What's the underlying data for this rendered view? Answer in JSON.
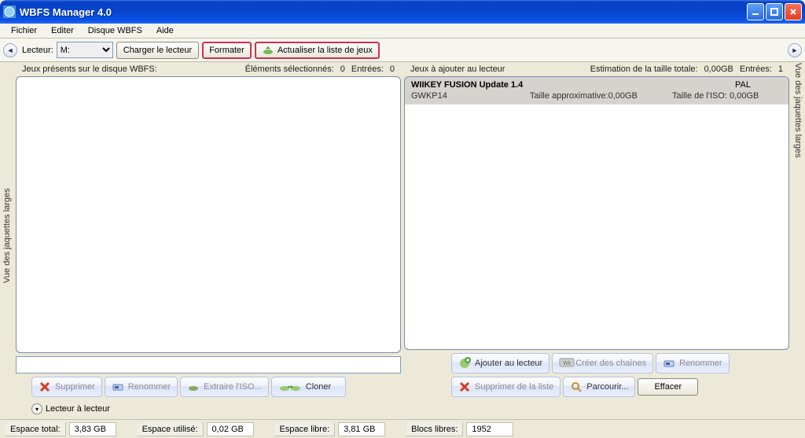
{
  "window": {
    "title": "WBFS Manager 4.0"
  },
  "menu": {
    "items": [
      "Fichier",
      "Editer",
      "Disque WBFS",
      "Aide"
    ]
  },
  "toolbar": {
    "drive_label": "Lecteur:",
    "drive_selected": "M:",
    "load_btn": "Charger le lecteur",
    "format_btn": "Formater",
    "refresh_btn": "Actualiser la liste de jeux"
  },
  "side_tab": {
    "left": "Vue des jaquettes larges",
    "right": "Vue des jaquettes larges"
  },
  "left_panel": {
    "title": "Jeux présents sur le disque WBFS:",
    "sel_label": "Éléments sélectionnés:",
    "sel_count": "0",
    "entries_label": "Entrées:",
    "entries_count": "0",
    "buttons": {
      "delete": "Supprimer",
      "rename": "Renommer",
      "extract": "Extraire l'ISO...",
      "clone": "Cloner"
    }
  },
  "right_panel": {
    "title": "Jeux à ajouter au lecteur",
    "size_est_label": "Estimation de la taille totale:",
    "size_est_val": "0,00GB",
    "entries_label": "Entrées:",
    "entries_count": "1",
    "items": [
      {
        "title": "WIIKEY FUSION Update 1.4",
        "id": "GWKP14",
        "approx_label": "Taille approximative:",
        "approx_val": "0,00GB",
        "iso_label": "Taille de l'ISO:",
        "iso_val": "0,00GB",
        "region": "PAL"
      }
    ],
    "buttons": {
      "add": "Ajouter au lecteur",
      "channels": "Créer des chaînes",
      "rename": "Renommer",
      "remove": "Supprimer de la liste",
      "browse": "Parcourir...",
      "clear": "Effacer"
    }
  },
  "expander": {
    "label": "Lecteur à lecteur"
  },
  "status": {
    "total_label": "Espace total:",
    "total_val": "3,83 GB",
    "used_label": "Espace utilisé:",
    "used_val": "0,02 GB",
    "free_label": "Espace libre:",
    "free_val": "3,81 GB",
    "blocks_label": "Blocs libres:",
    "blocks_val": "1952"
  }
}
